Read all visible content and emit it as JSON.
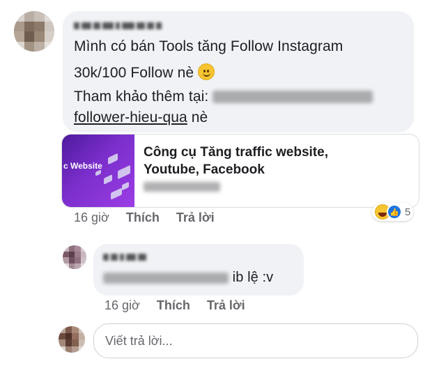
{
  "comment": {
    "author": "",
    "line1": "Mình có bán Tools tăng Follow Instagram",
    "line2": "30k/100 Follow nè",
    "line3_prefix": "Tham khảo thêm tại:",
    "link_suffix": "follower-hieu-qua",
    "line4_after": "nè",
    "emoji": "slightly-smiling-face-icon"
  },
  "link_card": {
    "thumb_text": "c Website",
    "title_line1": "Công cụ Tăng traffic website,",
    "title_line2": "Youtube, Facebook"
  },
  "comment_actions": {
    "time": "16 giờ",
    "like": "Thích",
    "reply": "Trả lời"
  },
  "reactions": {
    "types": [
      "haha-icon",
      "like-icon"
    ],
    "count": "5",
    "like_color": "#1b74e4",
    "haha_color": "#f7c531"
  },
  "reply": {
    "text_after_blur": "ib lệ :v",
    "time": "16 giờ",
    "like": "Thích",
    "reply": "Trả lời"
  },
  "reply_box": {
    "placeholder": "Viết trả lời..."
  },
  "colors": {
    "bubble": "#f0f2f5",
    "secondary_text": "#65676b",
    "primary_text": "#1c1e21"
  }
}
